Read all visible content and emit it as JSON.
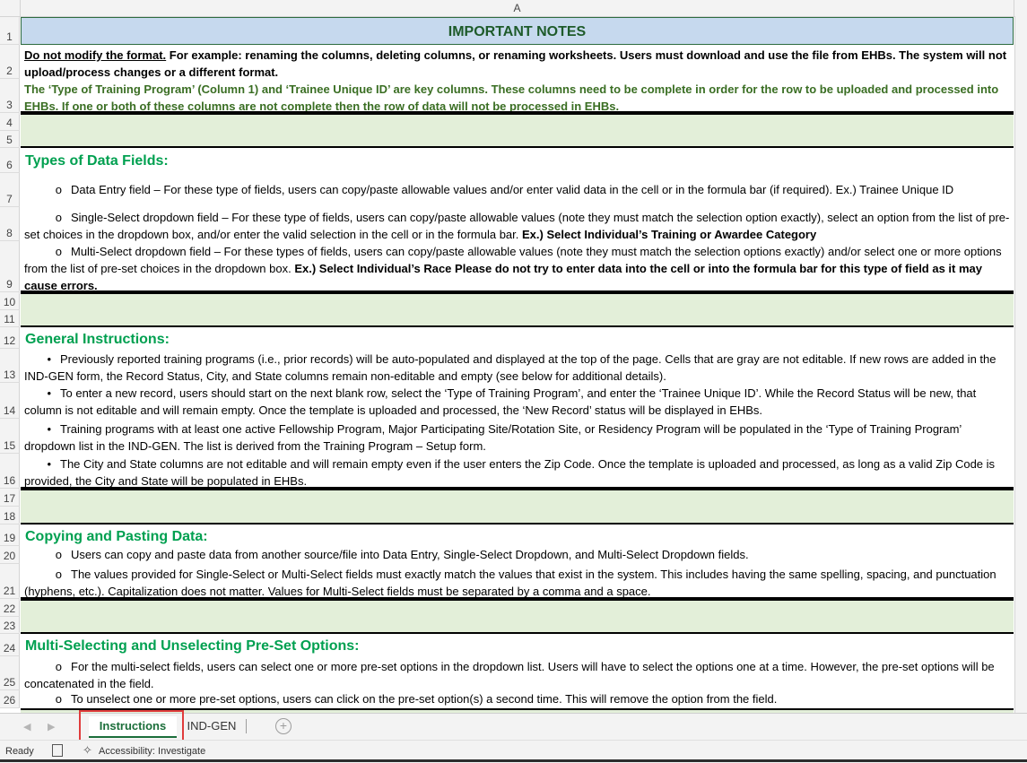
{
  "column_header": "A",
  "rows": [
    {
      "num": "1"
    },
    {
      "num": "2"
    },
    {
      "num": "3"
    },
    {
      "num": "4"
    },
    {
      "num": "5"
    },
    {
      "num": "6"
    },
    {
      "num": "7"
    },
    {
      "num": "8"
    },
    {
      "num": "9"
    },
    {
      "num": "10"
    },
    {
      "num": "11"
    },
    {
      "num": "12"
    },
    {
      "num": "13"
    },
    {
      "num": "14"
    },
    {
      "num": "15"
    },
    {
      "num": "16"
    },
    {
      "num": "17"
    },
    {
      "num": "18"
    },
    {
      "num": "19"
    },
    {
      "num": "20"
    },
    {
      "num": "21"
    },
    {
      "num": "22"
    },
    {
      "num": "23"
    },
    {
      "num": "24"
    },
    {
      "num": "25"
    },
    {
      "num": "26"
    }
  ],
  "title": "IMPORTANT NOTES",
  "row2": {
    "underline": "Do not modify the format.",
    "rest": " For example: renaming the columns, deleting columns, or renaming worksheets. Users must download and use the file from EHBs.  The system will not upload/process changes or a different format."
  },
  "row3": "The ‘Type of Training Program’ (Column 1) and ‘Trainee Unique ID’ are key columns. These columns need to be complete in order for the row to be uploaded and processed into EHBs. If one or both of these columns are not complete then the row of data will not be processed in EHBs.",
  "sections": {
    "types": "Types of Data Fields:",
    "general": "General Instructions:",
    "copying": "Copying and Pasting Data:",
    "multi": "Multi-Selecting and Unselecting Pre-Set Options:"
  },
  "bullets": {
    "circle": "o",
    "dot": "•"
  },
  "row7": "Data Entry field – For these type of fields, users can copy/paste allowable values and/or enter valid data in the cell or in the formula bar (if required). Ex.) Trainee Unique ID",
  "row8": {
    "text": "Single-Select dropdown field – For these type of fields, users can copy/paste allowable values (note they must match the selection option exactly), select an option from the list of pre-set choices in the dropdown box, and/or enter the valid selection in the cell or in the formula bar. ",
    "bold": "Ex.) Select Individual’s Training or Awardee Category"
  },
  "row9": {
    "text": "Multi-Select dropdown field – For these types of fields, users can copy/paste allowable values (note they must match the selection options exactly) and/or select one or more options from the list of pre-set choices in the dropdown box. ",
    "bold": "Ex.) Select Individual’s Race Please do not try to enter data into the cell or into the formula bar for this type of field as it may cause errors."
  },
  "row13": "Previously reported training programs (i.e., prior records) will be auto-populated and displayed at the top of the page. Cells that are gray are not editable. If new rows are added in the IND-GEN form, the Record Status, City, and State columns remain non-editable and empty (see below for additional details).",
  "row14": "To enter a new record, users should start on the next blank row, select the ‘Type of Training Program’, and enter the ‘Trainee Unique ID’. While the Record Status will be new, that column is not editable and will remain empty. Once the template is uploaded and processed, the ‘New Record’ status will be displayed in EHBs.",
  "row15": "Training programs with at least one active Fellowship Program, Major Participating Site/Rotation Site, or Residency Program will be populated in the ‘Type of Training Program’ dropdown list in the IND-GEN. The list is derived from the Training Program – Setup form.",
  "row16": "The City and State columns are not editable and will remain empty even if the user enters the Zip Code. Once the template is uploaded and processed, as long as a valid Zip Code is provided, the City and State will be populated in EHBs.",
  "row20": "Users can copy and paste data from another source/file into Data Entry, Single-Select Dropdown, and Multi-Select Dropdown fields.",
  "row21": "The values provided for Single-Select or Multi-Select fields must exactly match the values that exist in the system. This includes having the same spelling, spacing, and punctuation (hyphens, etc.). Capitalization does not matter. Values for Multi-Select fields must be separated by a comma and a space.",
  "row25": "For the multi-select fields, users can select one or more pre-set options in the dropdown list. Users will have to select the options one at a time. However, the pre-set options will be concatenated in the field.",
  "row26": "To unselect one or more pre-set options, users can click on the pre-set option(s) a second time. This will remove the option from the field.",
  "tabs": [
    {
      "label": "Instructions",
      "active": true
    },
    {
      "label": "IND-GEN",
      "active": false
    }
  ],
  "add_sheet_glyph": "+",
  "status": {
    "ready": "Ready",
    "accessibility": "Accessibility: Investigate"
  },
  "colors": {
    "title_bg": "#c6d9ee",
    "section_green": "#00a050",
    "band_green": "#e3efd9",
    "highlight_red": "#e03c3c"
  }
}
